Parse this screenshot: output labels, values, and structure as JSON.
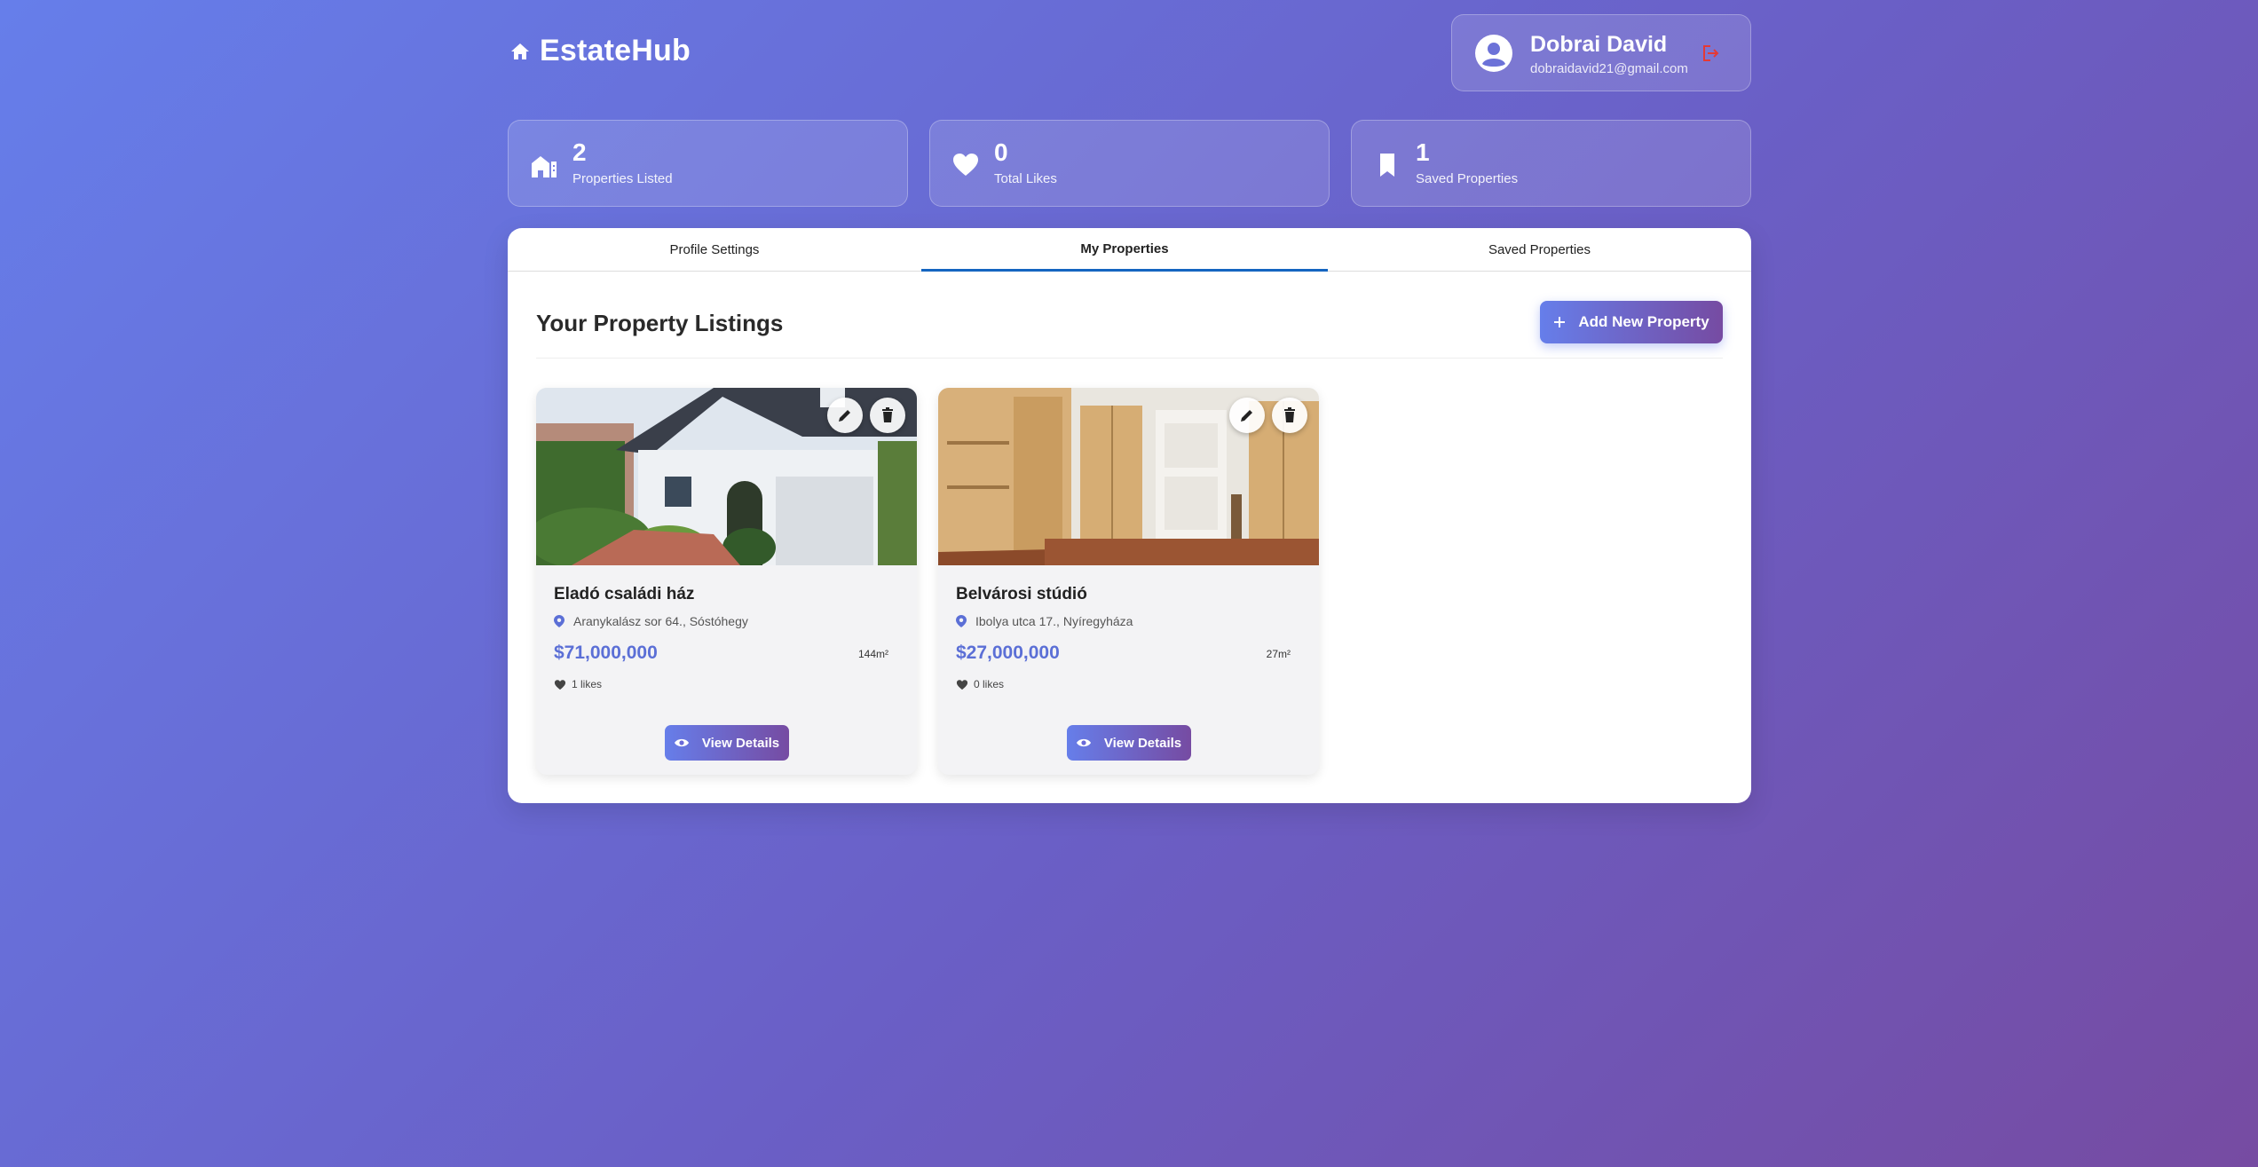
{
  "app": {
    "name": "EstateHub"
  },
  "user": {
    "name": "Dobrai David",
    "email": "dobraidavid21@gmail.com"
  },
  "stats": [
    {
      "value": "2",
      "label": "Properties Listed"
    },
    {
      "value": "0",
      "label": "Total Likes"
    },
    {
      "value": "1",
      "label": "Saved Properties"
    }
  ],
  "tabs": [
    {
      "label": "Profile Settings"
    },
    {
      "label": "My Properties"
    },
    {
      "label": "Saved Properties"
    }
  ],
  "active_tab": "My Properties",
  "section": {
    "title": "Your Property Listings",
    "add_label": "Add New Property"
  },
  "properties": [
    {
      "title": "Eladó családi ház",
      "location": "Aranykalász sor 64., Sóstóhegy",
      "price": "$71,000,000",
      "area": "144m²",
      "likes": "1 likes",
      "view_label": "View Details"
    },
    {
      "title": "Belvárosi stúdió",
      "location": "Ibolya utca 17., Nyíregyháza",
      "price": "$27,000,000",
      "area": "27m²",
      "likes": "0 likes",
      "view_label": "View Details"
    }
  ],
  "colors": {
    "accent": "#667eea",
    "accent_end": "#764ba2",
    "tab_active": "#1565c0",
    "price": "#5b6fd6",
    "logout": "#e53935"
  }
}
